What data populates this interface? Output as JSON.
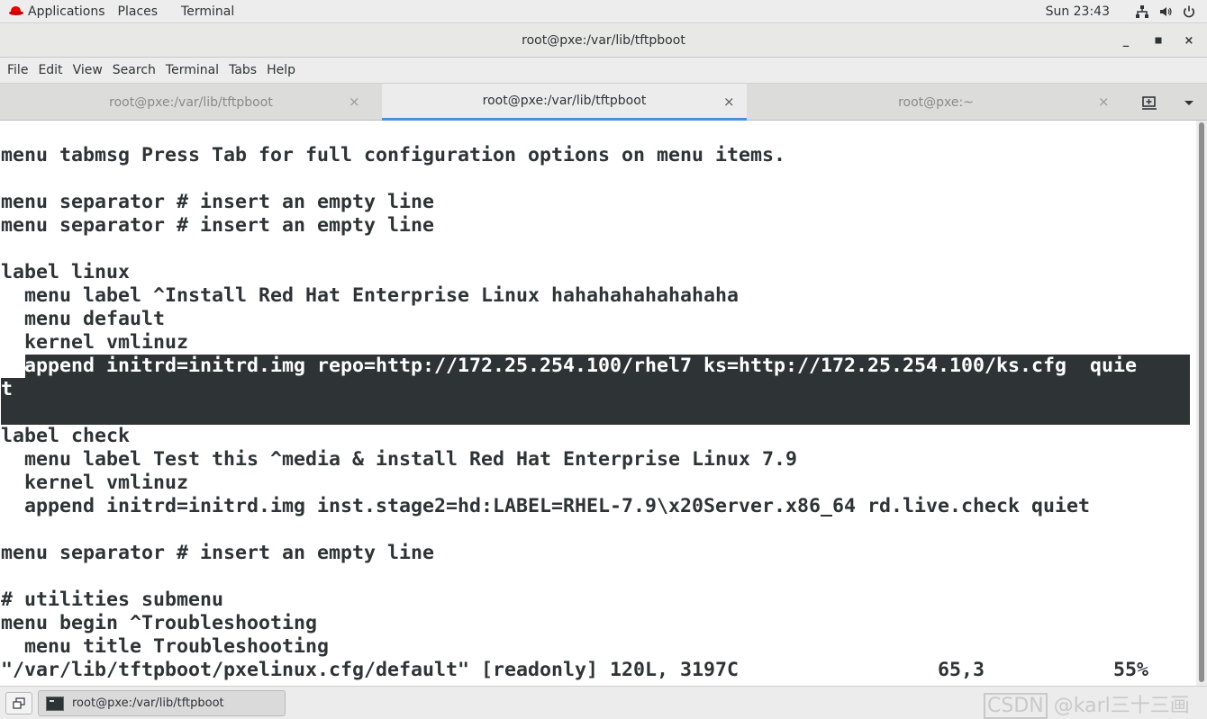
{
  "topbar": {
    "applications": "Applications",
    "places": "Places",
    "terminal": "Terminal",
    "clock": "Sun 23:43",
    "icons": [
      "network-icon",
      "volume-icon",
      "power-icon"
    ]
  },
  "window": {
    "title": "root@pxe:/var/lib/tftpboot",
    "minimize": "_",
    "maximize": "▫",
    "close": "×"
  },
  "menubar": [
    "File",
    "Edit",
    "View",
    "Search",
    "Terminal",
    "Tabs",
    "Help"
  ],
  "tabs": [
    {
      "label": "root@pxe:/var/lib/tftpboot",
      "active": false
    },
    {
      "label": "root@pxe:/var/lib/tftpboot",
      "active": true
    },
    {
      "label": "root@pxe:~",
      "active": false
    }
  ],
  "tab_close": "×",
  "terminal": {
    "lines": [
      "",
      "menu tabmsg Press Tab for full configuration options on menu items.",
      "",
      "menu separator # insert an empty line",
      "menu separator # insert an empty line",
      "",
      "label linux",
      "  menu label ^Install Red Hat Enterprise Linux hahahahahahahaha",
      "  menu default",
      "  kernel vmlinuz",
      "  append initrd=initrd.img repo=http://172.25.254.100/rhel7 ks=http://172.25.254.100/ks.cfg  quie",
      "t",
      "",
      "label check",
      "  menu label Test this ^media & install Red Hat Enterprise Linux 7.9",
      "  kernel vmlinuz",
      "  append initrd=initrd.img inst.stage2=hd:LABEL=RHEL-7.9\\x20Server.x86_64 rd.live.check quiet",
      "",
      "menu separator # insert an empty line",
      "",
      "# utilities submenu",
      "menu begin ^Troubleshooting",
      "  menu title Troubleshooting"
    ],
    "status": "\"/var/lib/tftpboot/pxelinux.cfg/default\" [readonly] 120L, 3197C                 65,3           55%"
  },
  "taskbar": {
    "task_label": "root@pxe:/var/lib/tftpboot",
    "watermark_box": "CSDN",
    "watermark_rest": " @karl三十三画"
  }
}
